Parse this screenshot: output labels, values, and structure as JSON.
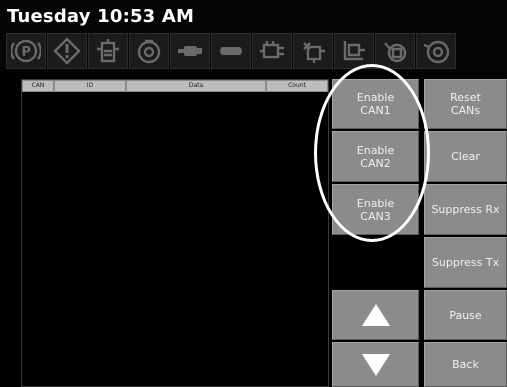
{
  "header": {
    "time": "Tuesday 10:53 AM"
  },
  "indicators": [
    {
      "icon": "parking-brake-icon"
    },
    {
      "icon": "warning-icon"
    },
    {
      "icon": "coolant-level-icon"
    },
    {
      "icon": "oil-pressure-icon"
    },
    {
      "icon": "transmission-icon"
    },
    {
      "icon": "engine-check-icon"
    },
    {
      "icon": "intake-heater-icon"
    },
    {
      "icon": "glow-plug-icon"
    },
    {
      "icon": "dpf-icon"
    },
    {
      "icon": "hydraulic-icon"
    },
    {
      "icon": "fuel-icon"
    }
  ],
  "log": {
    "columns": [
      "CAN",
      "ID",
      "Data",
      "Count"
    ],
    "rows": []
  },
  "buttons": {
    "enable_can1": "Enable\nCAN1",
    "enable_can2": "Enable\nCAN2",
    "enable_can3": "Enable\nCAN3",
    "reset_cans": "Reset\nCANs",
    "clear": "Clear",
    "suppress_rx": "Suppress Rx",
    "suppress_tx": "Suppress Tx",
    "pause": "Pause",
    "back": "Back"
  },
  "colors": {
    "button": "#8b8b8b",
    "background": "#000000",
    "highlight": "#ffffff"
  }
}
